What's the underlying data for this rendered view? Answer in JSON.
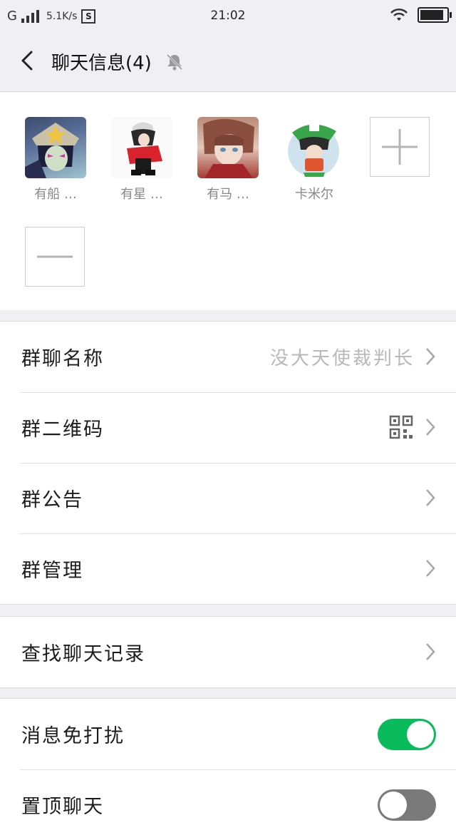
{
  "status_bar": {
    "network": "G",
    "net_speed": "5.1K/s",
    "s_badge": "S",
    "time": "21:02",
    "battery_level": 0.9
  },
  "header": {
    "title": "聊天信息(4)"
  },
  "members": [
    {
      "name": "有船 …"
    },
    {
      "name": "有星 …"
    },
    {
      "name": "有马 …"
    },
    {
      "name": "卡米尔"
    }
  ],
  "settings_group_1": [
    {
      "label": "群聊名称",
      "value": "没大天使裁判长"
    },
    {
      "label": "群二维码"
    },
    {
      "label": "群公告"
    },
    {
      "label": "群管理"
    }
  ],
  "settings_group_2": [
    {
      "label": "查找聊天记录"
    }
  ],
  "settings_group_3": [
    {
      "label": "消息免打扰",
      "toggle_on": true
    },
    {
      "label": "置顶聊天",
      "toggle_on": false
    }
  ],
  "colors": {
    "toggle_on": "#09bb5a",
    "toggle_off": "#7a7a7a"
  }
}
